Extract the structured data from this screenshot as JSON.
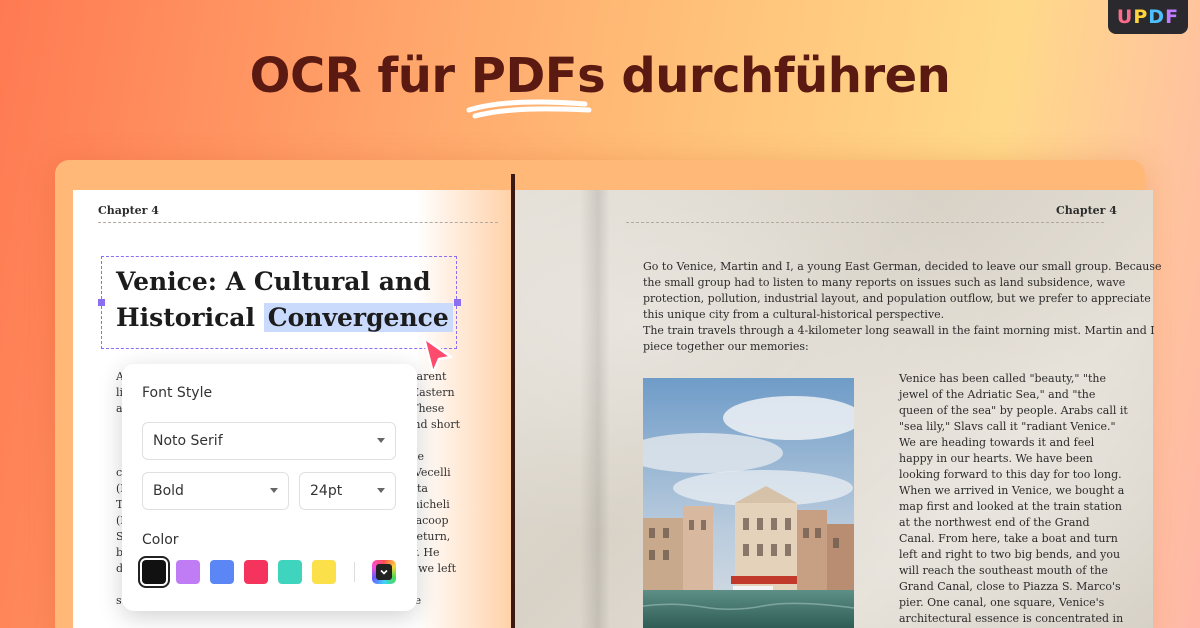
{
  "brand": {
    "logo_letters": [
      "U",
      "P",
      "D",
      "F"
    ]
  },
  "headline": {
    "part1": "OCR für ",
    "highlight": "PDFs",
    "part2": " durchführen"
  },
  "left_page": {
    "chapter": "Chapter 4",
    "title_line1": "Venice: A Cultural and",
    "title_line2_plain": "Historical ",
    "title_line2_selected": "Convergence",
    "body_lines": [
      "A                                                ves like Venus. Transparent",
      "li                                                . The convergence of Eastern",
      "a                                                e your wisdom in joy. These",
      "                                                  may be small in size and short",
      "                                                  In the Middle Ages, a",
      "                                                  , forging its own unique",
      "c                                                 erged, such as Titian Vecelli",
      "(I                                                 ), and Giovanni Battista",
      "T                                                 such as Michele Sanmicheli",
      "(I                                                 ulptor and architect Jacoop",
      "S                                                 rous offer for him to return,",
      "b                                                 an absolute monarchy. He",
      "d                                                 cided to go to Venice, we left",
      "                                                   reports about land",
      "su                                                lation outflow, and the"
    ]
  },
  "font_panel": {
    "font_style_label": "Font Style",
    "font_family": "Noto Serif",
    "font_weight": "Bold",
    "font_size": "24pt",
    "color_label": "Color",
    "swatches": [
      "#111111",
      "#c07cf5",
      "#5b86f5",
      "#f5345e",
      "#3fd4bd",
      "#fbe04a"
    ],
    "selected_swatch": "#111111"
  },
  "right_page": {
    "chapter": "Chapter 4",
    "intro_lines": [
      "Go to Venice, Martin and I, a young East German, decided to leave our small group. Because",
      "the small group had to listen to many reports on issues such as land subsidence, wave",
      "protection, pollution, industrial layout, and population outflow, but we prefer to appreciate",
      "this unique city from a cultural-historical perspective.",
      "The train travels through a 4-kilometer long seawall in the faint morning mist. Martin and I",
      "piece together our memories:"
    ],
    "column_lines": [
      "Venice has been called \"beauty,\" \"the",
      "jewel of the Adriatic Sea,\" and \"the",
      "queen of the sea\" by people. Arabs call it",
      "\"sea lily,\" Slavs call it \"radiant Venice.\"",
      "We are heading towards it and feel",
      "happy in our hearts. We have been",
      "looking forward to this day for too long.",
      "When we arrived in Venice, we bought a",
      "map first and looked at the train station",
      "at the northwest end of the Grand",
      "Canal. From here, take a boat and turn",
      "left and right to two big bends, and you",
      "will reach the southeast mouth of the",
      "Grand Canal, close to Piazza S. Marco's",
      "pier. One canal, one square, Venice's",
      "architectural essence is concentrated in"
    ]
  }
}
